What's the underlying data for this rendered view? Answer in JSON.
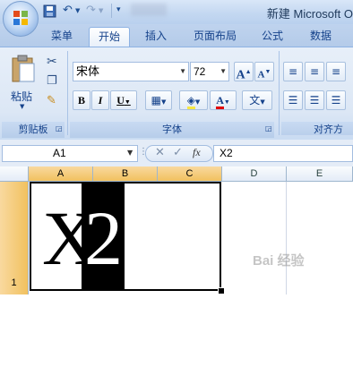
{
  "title_bar": {
    "title": "新建 Microsoft O",
    "qat_icons": [
      "save-icon",
      "undo-icon",
      "redo-icon",
      "customize-icon"
    ]
  },
  "tabs": [
    {
      "label": "菜单",
      "active": false
    },
    {
      "label": "开始",
      "active": true
    },
    {
      "label": "插入",
      "active": false
    },
    {
      "label": "页面布局",
      "active": false
    },
    {
      "label": "公式",
      "active": false
    },
    {
      "label": "数据",
      "active": false
    }
  ],
  "ribbon": {
    "clipboard": {
      "paste_label": "粘贴",
      "group_label": "剪贴板"
    },
    "font": {
      "font_name": "宋体",
      "font_size": "72",
      "group_label": "字体",
      "grow_label": "A",
      "shrink_label": "A",
      "bold_label": "B",
      "italic_label": "I",
      "underline_label": "U",
      "font_color_label": "A",
      "phonetic_label": "文",
      "font_color": "#e00000"
    },
    "alignment": {
      "group_label": "对齐方"
    }
  },
  "formula_bar": {
    "name_box": "A1",
    "formula": "X2"
  },
  "grid": {
    "columns": [
      "A",
      "B",
      "C",
      "D",
      "E"
    ],
    "selected_columns": [
      "A",
      "B",
      "C"
    ],
    "row": "1",
    "cells": {
      "A1": "X",
      "B1": "2"
    }
  },
  "watermark": "Bai 经验"
}
